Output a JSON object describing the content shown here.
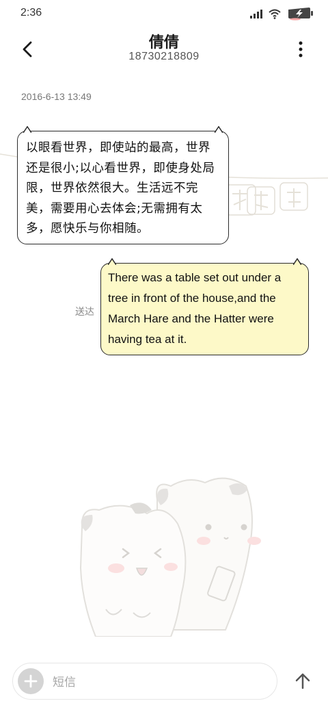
{
  "status_bar": {
    "time": "2:36",
    "icons": [
      "signal-icon",
      "wifi-icon",
      "battery-charging-icon"
    ]
  },
  "header": {
    "contact_name": "倩倩",
    "phone_number": "18730218809",
    "icons": [
      "back-arrow-icon",
      "more-vertical-icon"
    ]
  },
  "conversation": {
    "timestamp": "2016-6-13 13:49",
    "messages": [
      {
        "direction": "incoming",
        "text": "以眼看世界，即使站的最高，世界还是很小;以心看世界，即使身处局限，世界依然很大。生活远不完美，需要用心去体会;无需拥有太多，愿快乐与你相随。"
      },
      {
        "direction": "outgoing",
        "text": "There was a table set out under a tree in front of the house,and the March Hare and the Hatter were having tea at it.",
        "status": "送达"
      }
    ]
  },
  "input_bar": {
    "placeholder": "短信",
    "value": "",
    "icons": [
      "plus-icon",
      "send-arrow-up-icon"
    ]
  },
  "colors": {
    "outgoing_bubble": "#fdf9c8",
    "incoming_bubble": "#ffffff",
    "bubble_border": "#2b2b2b",
    "add_button": "#d4d4d4"
  }
}
